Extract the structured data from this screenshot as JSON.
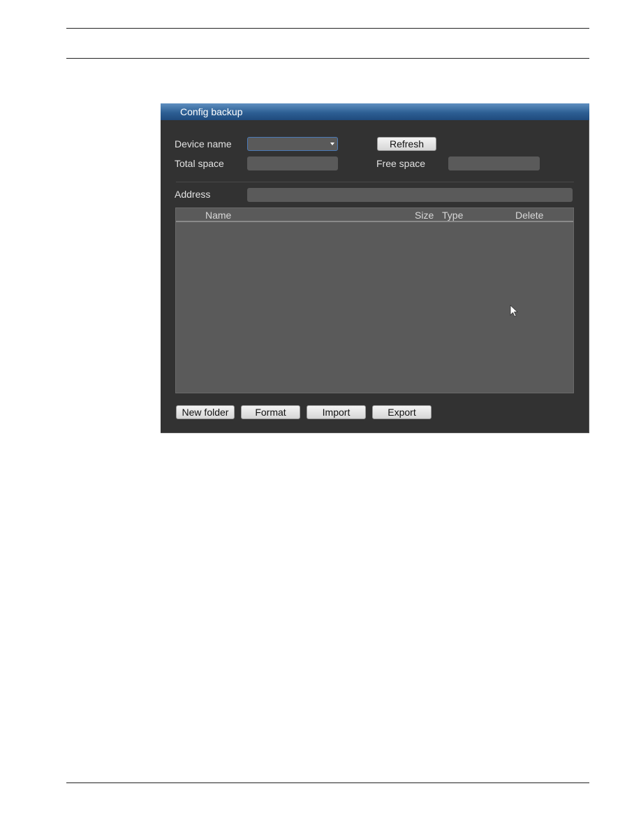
{
  "dialog": {
    "title": "Config backup",
    "device_name_label": "Device name",
    "device_name_value": "",
    "refresh_label": "Refresh",
    "total_space_label": "Total space",
    "total_space_value": "",
    "free_space_label": "Free space",
    "free_space_value": "",
    "address_label": "Address",
    "address_value": "",
    "table": {
      "columns": [
        "Name",
        "Size",
        "Type",
        "Delete"
      ],
      "rows": []
    },
    "buttons": {
      "new_folder": "New folder",
      "format": "Format",
      "import": "Import",
      "export": "Export"
    }
  }
}
